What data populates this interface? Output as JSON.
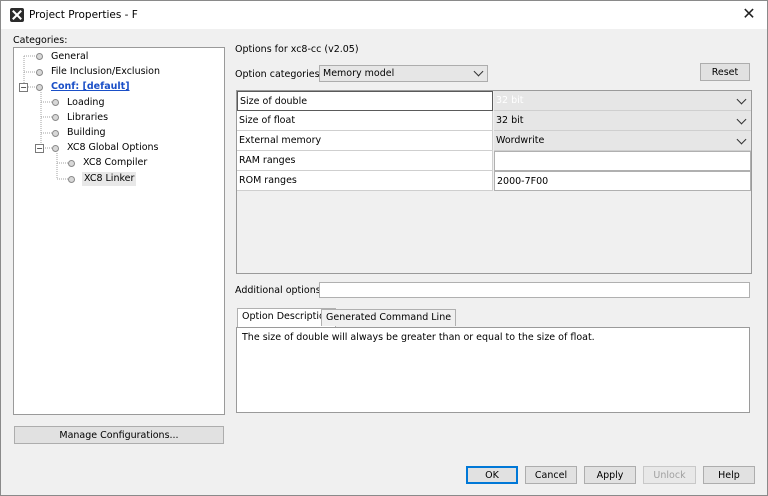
{
  "window": {
    "title": "Project Properties - F",
    "close_glyph": "✕"
  },
  "categories": {
    "label": "Categories:",
    "items": [
      {
        "label": "General",
        "icon": "leaf-dot-icon"
      },
      {
        "label": "File Inclusion/Exclusion",
        "icon": "leaf-dot-icon"
      },
      {
        "label": "Conf: [default]",
        "icon": "leaf-dot-icon",
        "expanded": true
      },
      {
        "label": "Loading",
        "icon": "leaf-dot-icon"
      },
      {
        "label": "Libraries",
        "icon": "leaf-dot-icon"
      },
      {
        "label": "Building",
        "icon": "leaf-dot-icon"
      },
      {
        "label": "XC8 Global Options",
        "icon": "leaf-dot-icon",
        "expanded": true
      },
      {
        "label": "XC8 Compiler",
        "icon": "leaf-dot-icon"
      },
      {
        "label": "XC8 Linker",
        "icon": "leaf-dot-icon",
        "selected": true
      }
    ],
    "toggle_minus": "−"
  },
  "manage_button": "Manage Configurations...",
  "options": {
    "header": "Options for xc8-cc (v2.05)",
    "category_label": "Option categories:",
    "category_value": "Memory model",
    "reset_label": "Reset",
    "rows": [
      {
        "name": "Size of double",
        "value": "32 bit"
      },
      {
        "name": "Size of float",
        "value": "32 bit"
      },
      {
        "name": "External memory",
        "value": "Wordwrite"
      },
      {
        "name": "RAM ranges",
        "value": ""
      },
      {
        "name": "ROM ranges",
        "value": "2000-7F00"
      }
    ],
    "additional_label": "Additional options:",
    "additional_value": ""
  },
  "tabs": [
    "Option Description",
    "Generated Command Line"
  ],
  "description": "The size of double will always be greater than or equal to the size of float.",
  "buttons": {
    "ok": "OK",
    "cancel": "Cancel",
    "apply": "Apply",
    "unlock": "Unlock",
    "help": "Help"
  }
}
